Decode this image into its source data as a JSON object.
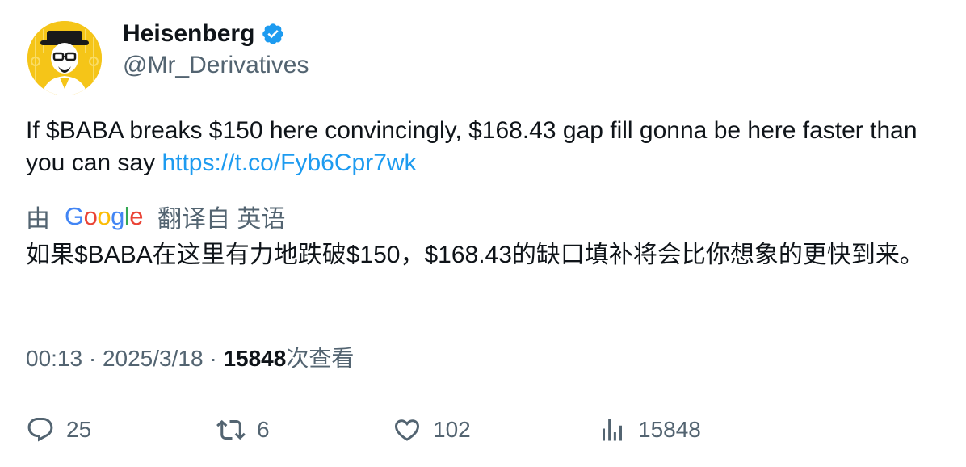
{
  "author": {
    "display_name": "Heisenberg",
    "handle": "@Mr_Derivatives",
    "verified": true,
    "avatar_icon": "heisenberg-avatar-icon"
  },
  "tweet": {
    "text": "If $BABA breaks $150 here convincingly, $168.43 gap fill gonna be here faster than you can say ",
    "link": "https://t.co/Fyb6Cpr7wk"
  },
  "translation": {
    "prefix": "由",
    "provider": "Google",
    "suffix": "翻译自 英语",
    "text": "如果$BABA在这里有力地跌破$150，$168.43的缺口填补将会比你想象的更快到来。"
  },
  "meta": {
    "time": "00:13",
    "separator": " · ",
    "date": "2025/3/18",
    "views": "15848",
    "views_suffix": "次查看"
  },
  "actions": {
    "replies": "25",
    "retweets": "6",
    "likes": "102",
    "views": "15848"
  },
  "colors": {
    "accent": "#1d9bf0",
    "secondary_text": "#536471",
    "primary_text": "#0f1419",
    "google_blue": "#4285F4",
    "google_red": "#EA4335",
    "google_yellow": "#FBBC05",
    "google_green": "#34A853"
  }
}
